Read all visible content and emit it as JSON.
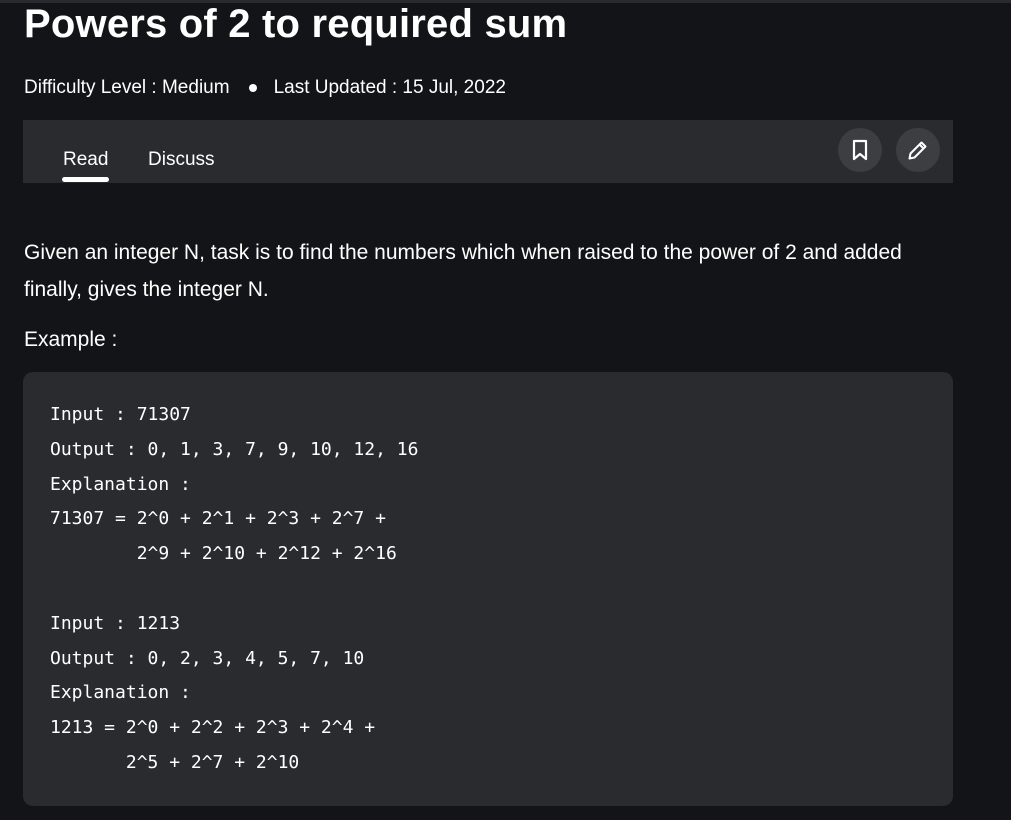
{
  "article": {
    "title": "Powers of 2 to required sum",
    "difficulty": "Difficulty Level : Medium",
    "last_updated": "Last Updated : 15 Jul, 2022"
  },
  "tabs": {
    "read": "Read",
    "discuss": "Discuss"
  },
  "icons": {
    "bookmark": "bookmark-icon",
    "edit": "pencil-icon"
  },
  "content": {
    "description": "Given an integer N, task is to find the numbers which when raised to the power of 2 and added finally, gives the integer N.",
    "example_label": "Example :",
    "code_lines": [
      "Input : 71307",
      "Output : 0, 1, 3, 7, 9, 10, 12, 16",
      "Explanation :",
      "71307 = 2^0 + 2^1 + 2^3 + 2^7 +",
      "        2^9 + 2^10 + 2^12 + 2^16",
      "",
      "Input : 1213",
      "Output : 0, 2, 3, 4, 5, 7, 10",
      "Explanation :",
      "1213 = 2^0 + 2^2 + 2^3 + 2^4 +",
      "       2^5 + 2^7 + 2^10"
    ]
  },
  "colors": {
    "background": "#131417",
    "panel": "#2a2b2f",
    "button": "#3d3e42",
    "text": "#ffffff"
  }
}
